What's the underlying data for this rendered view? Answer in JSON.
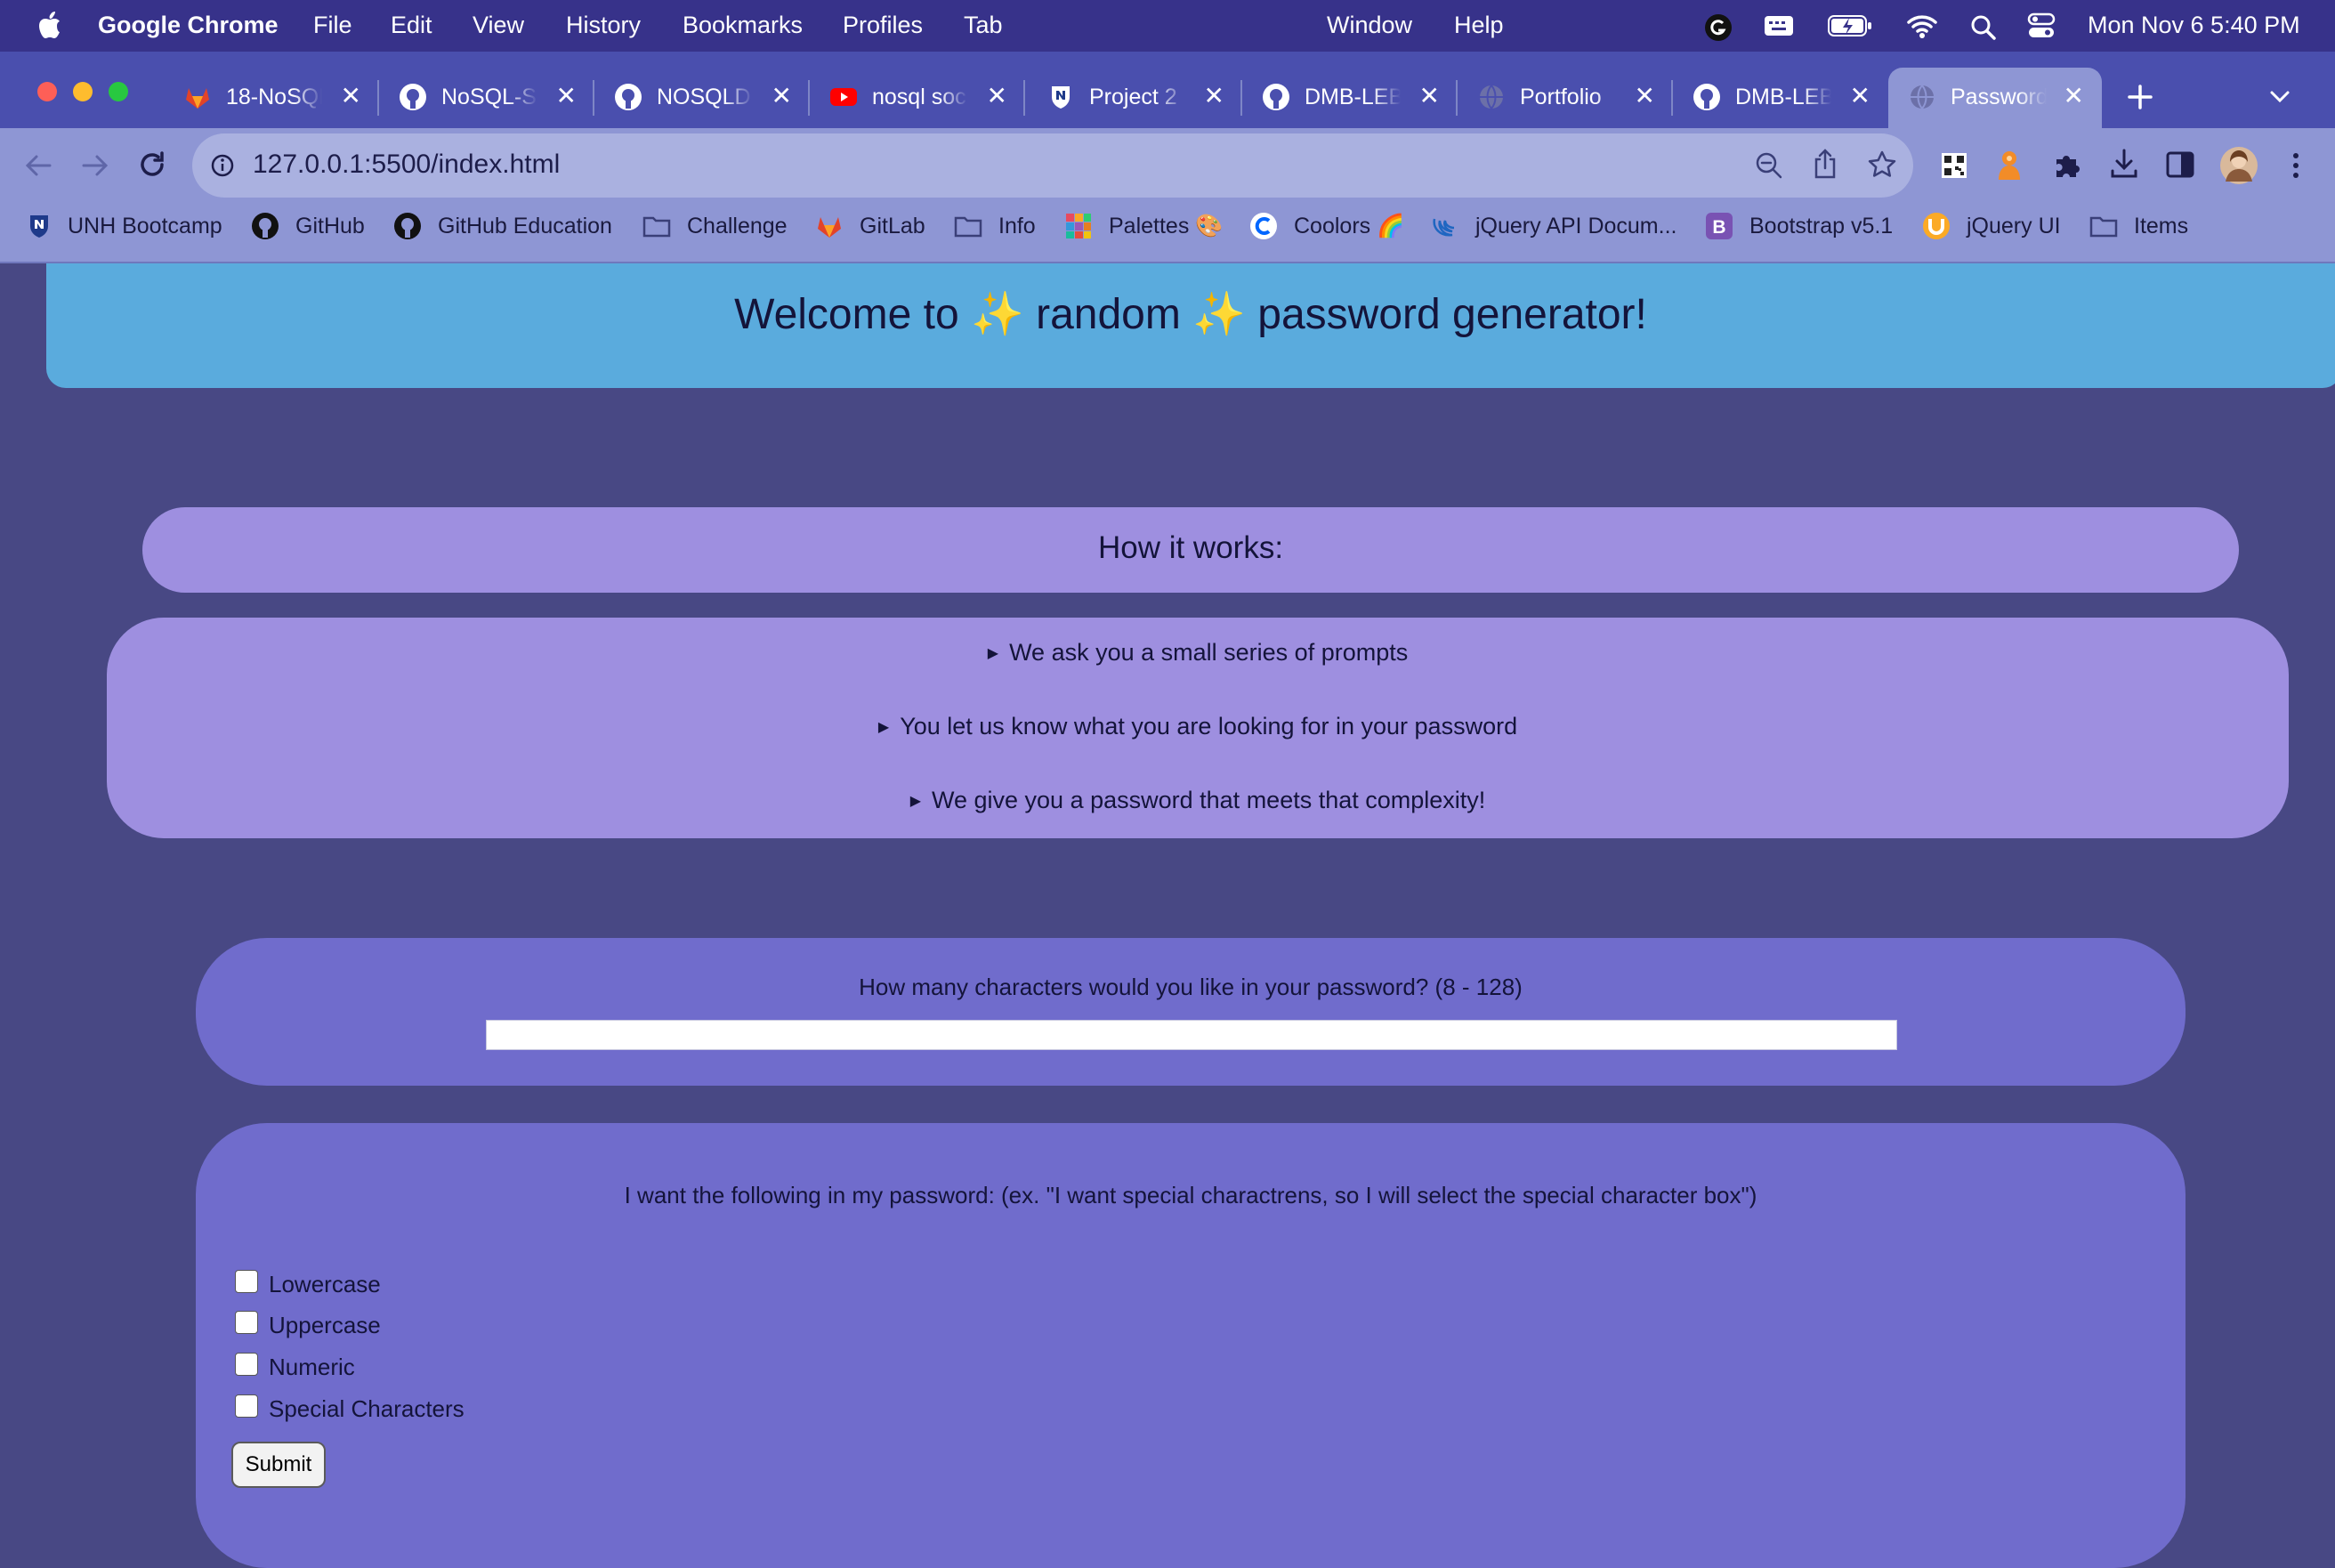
{
  "menubar": {
    "app_name": "Google Chrome",
    "items": [
      "File",
      "Edit",
      "View",
      "History",
      "Bookmarks",
      "Profiles",
      "Tab",
      "Window",
      "Help"
    ],
    "datetime": "Mon Nov 6  5:40 PM"
  },
  "tabs": [
    {
      "title": "18-NoSQL",
      "icon": "gitlab-icon"
    },
    {
      "title": "NoSQL-S",
      "icon": "github-icon"
    },
    {
      "title": "NOSQLD",
      "icon": "github-icon"
    },
    {
      "title": "nosql soc",
      "icon": "youtube-icon"
    },
    {
      "title": "Project 2",
      "icon": "unh-shield-icon"
    },
    {
      "title": "DMB-LEB",
      "icon": "github-icon"
    },
    {
      "title": "Portfolio",
      "icon": "globe-icon"
    },
    {
      "title": "DMB-LEB",
      "icon": "github-icon"
    },
    {
      "title": "Password",
      "icon": "globe-icon",
      "active": true
    }
  ],
  "address_bar": {
    "url": "127.0.0.1:5500/index.html"
  },
  "bookmarks": [
    {
      "label": "UNH Bootcamp",
      "icon": "unh-shield-icon"
    },
    {
      "label": "GitHub",
      "icon": "github-icon"
    },
    {
      "label": "GitHub Education",
      "icon": "github-icon"
    },
    {
      "label": "Challenge",
      "icon": "folder-icon"
    },
    {
      "label": "GitLab",
      "icon": "gitlab-icon"
    },
    {
      "label": "Info",
      "icon": "folder-icon"
    },
    {
      "label": "Palettes 🎨",
      "icon": "palette-grid-icon"
    },
    {
      "label": "Coolors 🌈",
      "icon": "coolors-icon"
    },
    {
      "label": "jQuery API Docum...",
      "icon": "jquery-icon"
    },
    {
      "label": "Bootstrap v5.1",
      "icon": "bootstrap-icon"
    },
    {
      "label": "jQuery UI",
      "icon": "jquery-ui-icon"
    },
    {
      "label": "Items",
      "icon": "folder-icon"
    }
  ],
  "page": {
    "heading": "Welcome to ✨ random ✨ password generator!",
    "how_title": "How it works:",
    "steps": [
      "We ask you a small series of prompts",
      "You let us know what you are looking for in your password",
      "We give you a password that meets that complexity!"
    ],
    "length_prompt": "How many characters would you like in your password? (8 - 128)",
    "length_value": "",
    "criteria_prompt": "I want the following in my password: (ex. \"I want special charactrens, so I will select the special character box\")",
    "options": [
      "Lowercase",
      "Uppercase",
      "Numeric",
      "Special Characters"
    ],
    "options_checked": [
      false,
      false,
      false,
      false
    ],
    "submit_label": "Submit"
  },
  "colors": {
    "page_bg": "#484884",
    "banner": "#5aabdd",
    "light_purple": "#9e8fe0",
    "mid_purple": "#706ccc",
    "chrome_toolbar": "#8e96d4",
    "menubar": "#37328a"
  }
}
